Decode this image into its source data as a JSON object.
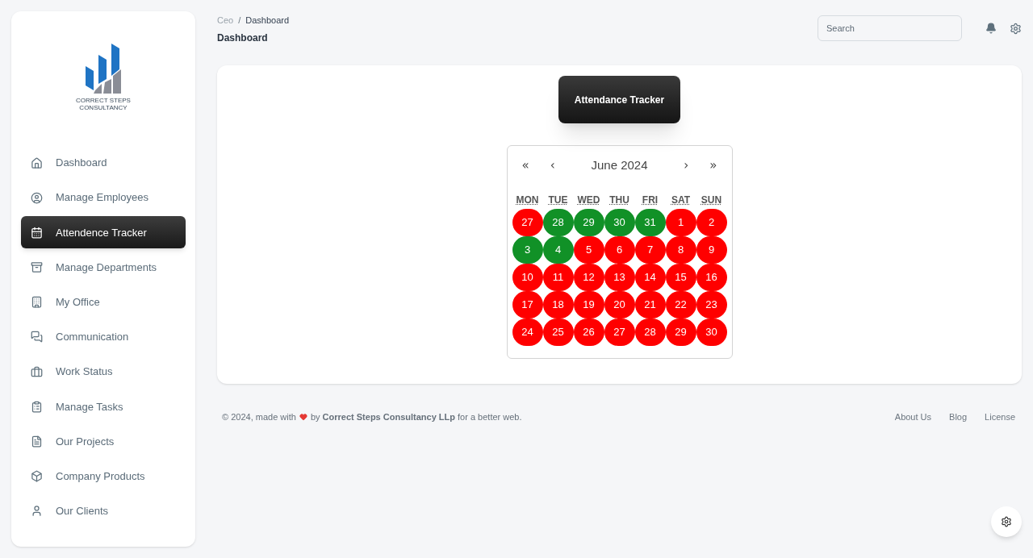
{
  "logo": {
    "line_1": "CORRECT STEPS",
    "line_2": "CONSULTANCY"
  },
  "sidebar": {
    "items": [
      {
        "label": "Dashboard",
        "selected": false
      },
      {
        "label": "Manage Employees",
        "selected": false
      },
      {
        "label": "Attendence Tracker",
        "selected": true
      },
      {
        "label": "Manage Departments",
        "selected": false
      },
      {
        "label": "My Office",
        "selected": false
      },
      {
        "label": "Communication",
        "selected": false
      },
      {
        "label": "Work Status",
        "selected": false
      },
      {
        "label": "Manage Tasks",
        "selected": false
      },
      {
        "label": "Our Projects",
        "selected": false
      },
      {
        "label": "Company Products",
        "selected": false
      },
      {
        "label": "Our Clients",
        "selected": false
      }
    ]
  },
  "breadcrumb": {
    "parent": "Ceo",
    "separator": "/",
    "current": "Dashboard"
  },
  "page_title": "Dashboard",
  "search": {
    "placeholder": "Search"
  },
  "card": {
    "button": "Attendance Tracker",
    "calendar": {
      "first": "«",
      "prev": "‹",
      "month": "June 2024",
      "next": "›",
      "last": "»",
      "weekdays": [
        "MON",
        "TUE",
        "WED",
        "THU",
        "FRI",
        "SAT",
        "SUN"
      ],
      "days": [
        {
          "label": "27",
          "color": "#ff0000"
        },
        {
          "label": "28",
          "color": "#119127"
        },
        {
          "label": "29",
          "color": "#119127"
        },
        {
          "label": "30",
          "color": "#119127"
        },
        {
          "label": "31",
          "color": "#119127"
        },
        {
          "label": "1",
          "color": "#ff0000"
        },
        {
          "label": "2",
          "color": "#ff0000"
        },
        {
          "label": "3",
          "color": "#119127"
        },
        {
          "label": "4",
          "color": "#119127"
        },
        {
          "label": "5",
          "color": "#ff0000"
        },
        {
          "label": "6",
          "color": "#ff0000"
        },
        {
          "label": "7",
          "color": "#ff0000"
        },
        {
          "label": "8",
          "color": "#ff0000"
        },
        {
          "label": "9",
          "color": "#ff0000"
        },
        {
          "label": "10",
          "color": "#ff0000"
        },
        {
          "label": "11",
          "color": "#ff0000"
        },
        {
          "label": "12",
          "color": "#ff0000"
        },
        {
          "label": "13",
          "color": "#ff0000"
        },
        {
          "label": "14",
          "color": "#ff0000"
        },
        {
          "label": "15",
          "color": "#ff0000"
        },
        {
          "label": "16",
          "color": "#ff0000"
        },
        {
          "label": "17",
          "color": "#ff0000"
        },
        {
          "label": "18",
          "color": "#ff0000"
        },
        {
          "label": "19",
          "color": "#ff0000"
        },
        {
          "label": "20",
          "color": "#ff0000"
        },
        {
          "label": "21",
          "color": "#ff0000"
        },
        {
          "label": "22",
          "color": "#ff0000"
        },
        {
          "label": "23",
          "color": "#ff0000"
        },
        {
          "label": "24",
          "color": "#ff0000"
        },
        {
          "label": "25",
          "color": "#ff0000"
        },
        {
          "label": "26",
          "color": "#ff0000"
        },
        {
          "label": "27",
          "color": "#ff0000"
        },
        {
          "label": "28",
          "color": "#ff0000"
        },
        {
          "label": "29",
          "color": "#ff0000"
        },
        {
          "label": "30",
          "color": "#ff0000"
        }
      ]
    }
  },
  "footer": {
    "text": "© 2024, made with",
    "text_2": "by **Correct Steps Consultancy LLp** for a better web.",
    "links": [
      "About Us",
      "Blog",
      "License"
    ]
  }
}
